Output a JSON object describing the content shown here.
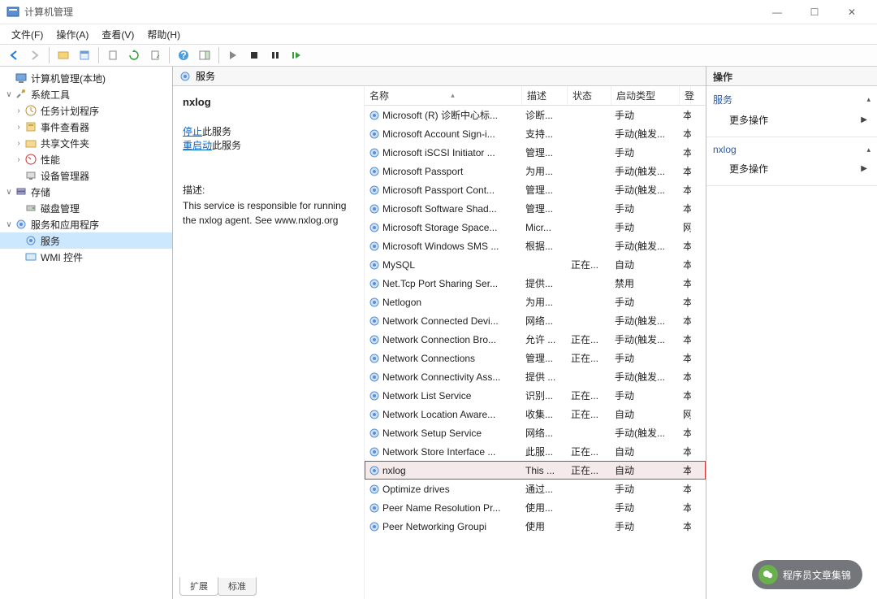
{
  "window": {
    "title": "计算机管理"
  },
  "win_controls": {
    "min": "—",
    "max": "☐",
    "close": "✕"
  },
  "menubar": [
    "文件(F)",
    "操作(A)",
    "查看(V)",
    "帮助(H)"
  ],
  "tree": [
    {
      "indent": 0,
      "tw": "",
      "icon": "computer",
      "label": "计算机管理(本地)"
    },
    {
      "indent": 0,
      "tw": "∨",
      "icon": "tools",
      "label": "系统工具"
    },
    {
      "indent": 1,
      "tw": "›",
      "icon": "clock",
      "label": "任务计划程序"
    },
    {
      "indent": 1,
      "tw": "›",
      "icon": "event",
      "label": "事件查看器"
    },
    {
      "indent": 1,
      "tw": "›",
      "icon": "share",
      "label": "共享文件夹"
    },
    {
      "indent": 1,
      "tw": "›",
      "icon": "perf",
      "label": "性能"
    },
    {
      "indent": 1,
      "tw": "",
      "icon": "device",
      "label": "设备管理器"
    },
    {
      "indent": 0,
      "tw": "∨",
      "icon": "storage",
      "label": "存储"
    },
    {
      "indent": 1,
      "tw": "",
      "icon": "disk",
      "label": "磁盘管理"
    },
    {
      "indent": 0,
      "tw": "∨",
      "icon": "services-app",
      "label": "服务和应用程序"
    },
    {
      "indent": 1,
      "tw": "",
      "icon": "gear",
      "label": "服务",
      "selected": true
    },
    {
      "indent": 1,
      "tw": "",
      "icon": "wmi",
      "label": "WMI 控件"
    }
  ],
  "center": {
    "header_label": "服务",
    "selected_service": "nxlog",
    "stop_prefix": "停止",
    "stop_suffix": "此服务",
    "restart_prefix": "重启动",
    "restart_suffix": "此服务",
    "desc_label": "描述:",
    "desc_text": "This service is responsible for running the nxlog agent. See www.nxlog.org",
    "columns": {
      "name": "名称",
      "desc": "描述",
      "status": "状态",
      "startup": "启动类型",
      "logon": "登"
    },
    "tabs": {
      "extended": "扩展",
      "standard": "标准"
    }
  },
  "services": [
    {
      "name": "Microsoft (R) 诊断中心标...",
      "desc": "诊断...",
      "status": "",
      "start": "手动",
      "log": "本"
    },
    {
      "name": "Microsoft Account Sign-i...",
      "desc": "支持...",
      "status": "",
      "start": "手动(触发...",
      "log": "本"
    },
    {
      "name": "Microsoft iSCSI Initiator ...",
      "desc": "管理...",
      "status": "",
      "start": "手动",
      "log": "本"
    },
    {
      "name": "Microsoft Passport",
      "desc": "为用...",
      "status": "",
      "start": "手动(触发...",
      "log": "本"
    },
    {
      "name": "Microsoft Passport Cont...",
      "desc": "管理...",
      "status": "",
      "start": "手动(触发...",
      "log": "本"
    },
    {
      "name": "Microsoft Software Shad...",
      "desc": "管理...",
      "status": "",
      "start": "手动",
      "log": "本"
    },
    {
      "name": "Microsoft Storage Space...",
      "desc": "Micr...",
      "status": "",
      "start": "手动",
      "log": "网"
    },
    {
      "name": "Microsoft Windows SMS ...",
      "desc": "根据...",
      "status": "",
      "start": "手动(触发...",
      "log": "本"
    },
    {
      "name": "MySQL",
      "desc": "",
      "status": "正在...",
      "start": "自动",
      "log": "本"
    },
    {
      "name": "Net.Tcp Port Sharing Ser...",
      "desc": "提供...",
      "status": "",
      "start": "禁用",
      "log": "本"
    },
    {
      "name": "Netlogon",
      "desc": "为用...",
      "status": "",
      "start": "手动",
      "log": "本"
    },
    {
      "name": "Network Connected Devi...",
      "desc": "网络...",
      "status": "",
      "start": "手动(触发...",
      "log": "本"
    },
    {
      "name": "Network Connection Bro...",
      "desc": "允许 ...",
      "status": "正在...",
      "start": "手动(触发...",
      "log": "本"
    },
    {
      "name": "Network Connections",
      "desc": "管理...",
      "status": "正在...",
      "start": "手动",
      "log": "本"
    },
    {
      "name": "Network Connectivity Ass...",
      "desc": "提供 ...",
      "status": "",
      "start": "手动(触发...",
      "log": "本"
    },
    {
      "name": "Network List Service",
      "desc": "识别...",
      "status": "正在...",
      "start": "手动",
      "log": "本"
    },
    {
      "name": "Network Location Aware...",
      "desc": "收集...",
      "status": "正在...",
      "start": "自动",
      "log": "网"
    },
    {
      "name": "Network Setup Service",
      "desc": "网络...",
      "status": "",
      "start": "手动(触发...",
      "log": "本"
    },
    {
      "name": "Network Store Interface ...",
      "desc": "此服...",
      "status": "正在...",
      "start": "自动",
      "log": "本"
    },
    {
      "name": "nxlog",
      "desc": "This ...",
      "status": "正在...",
      "start": "自动",
      "log": "本",
      "highlight": true
    },
    {
      "name": "Optimize drives",
      "desc": "通过...",
      "status": "",
      "start": "手动",
      "log": "本"
    },
    {
      "name": "Peer Name Resolution Pr...",
      "desc": "使用...",
      "status": "",
      "start": "手动",
      "log": "本"
    },
    {
      "name": "Peer Networking Groupi",
      "desc": "使用",
      "status": "",
      "start": "手动",
      "log": "本"
    }
  ],
  "actions": {
    "header": "操作",
    "section1_title": "服务",
    "section1_item": "更多操作",
    "section2_title": "nxlog",
    "section2_item": "更多操作"
  },
  "watermark": "程序员文章集锦"
}
